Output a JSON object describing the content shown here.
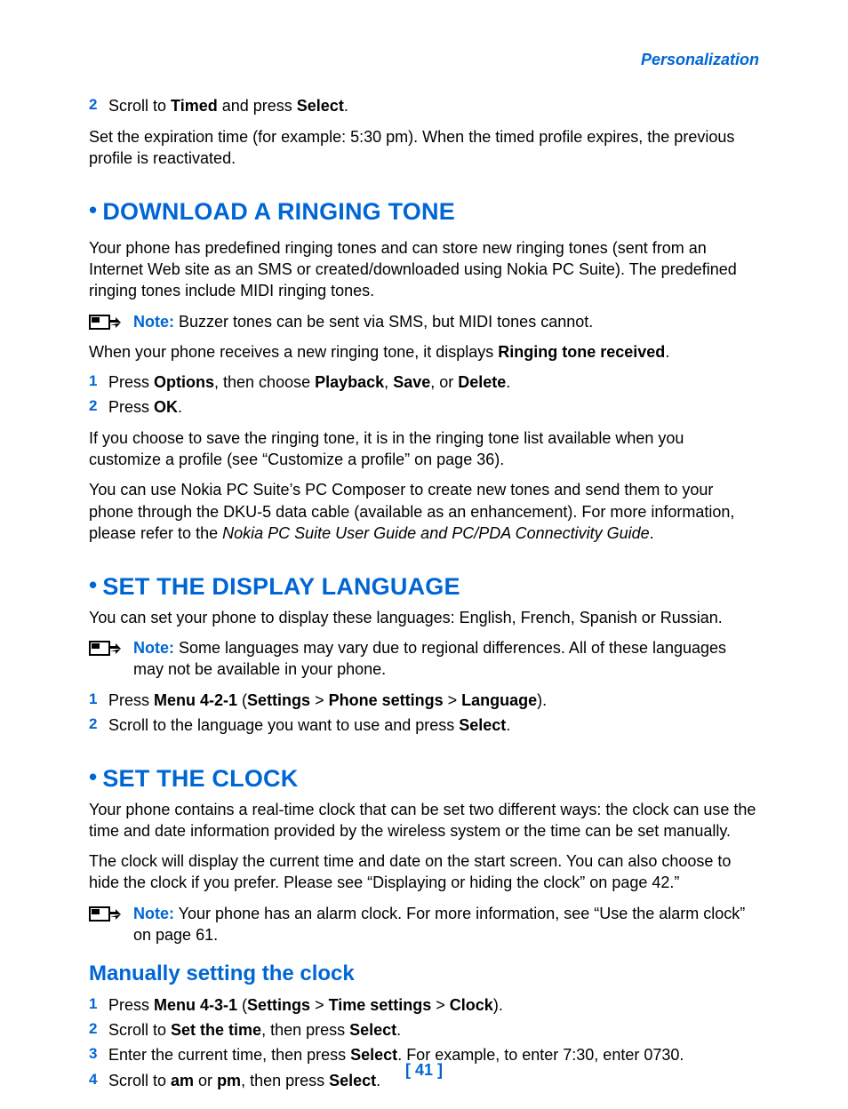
{
  "header": {
    "section": "Personalization"
  },
  "pre": {
    "step2_num": "2",
    "step2_prefix": "Scroll to ",
    "step2_b1": "Timed",
    "step2_mid": " and press ",
    "step2_b2": "Select",
    "step2_suffix": ".",
    "para": "Set the expiration time (for example: 5:30 pm). When the timed profile expires, the previous profile is reactivated."
  },
  "ringing": {
    "title": "DOWNLOAD A RINGING TONE",
    "p1": "Your phone has predefined ringing tones and can store new ringing tones (sent from an Internet Web site as an SMS or created/downloaded using Nokia PC Suite). The predefined ringing tones include MIDI ringing tones.",
    "note_label": "Note:",
    "note": " Buzzer tones can be sent via SMS, but MIDI tones cannot.",
    "p2_prefix": "When your phone receives a new ringing tone, it displays ",
    "p2_b": "Ringing tone received",
    "p2_suffix": ".",
    "s1_num": "1",
    "s1_a": "Press ",
    "s1_b1": "Options",
    "s1_c": ", then choose ",
    "s1_b2": "Playback",
    "s1_d": ", ",
    "s1_b3": "Save",
    "s1_e": ", or ",
    "s1_b4": "Delete",
    "s1_f": ".",
    "s2_num": "2",
    "s2_a": "Press ",
    "s2_b": "OK",
    "s2_c": ".",
    "p3": "If you choose to save the ringing tone, it is in the ringing tone list available when you customize a profile (see “Customize a profile” on page 36).",
    "p4_a": "You can use Nokia PC Suite’s PC Composer to create new tones and send them to your phone through the DKU-5 data cable (available as an enhancement). For more information, please refer to the ",
    "p4_i": "Nokia PC Suite User Guide and PC/PDA Connectivity Guide",
    "p4_b": "."
  },
  "lang": {
    "title": "SET THE DISPLAY LANGUAGE",
    "p1": "You can set your phone to display these languages: English, French, Spanish or Russian.",
    "note_label": "Note:",
    "note": " Some languages may vary due to regional differences. All of these languages may not be available in your phone.",
    "s1_num": "1",
    "s1_a": "Press ",
    "s1_b1": "Menu 4-2-1",
    "s1_c": " (",
    "s1_b2": "Settings",
    "s1_d": " > ",
    "s1_b3": "Phone settings",
    "s1_e": " > ",
    "s1_b4": "Language",
    "s1_f": ").",
    "s2_num": "2",
    "s2_a": "Scroll to the language you want to use and press ",
    "s2_b": "Select",
    "s2_c": "."
  },
  "clock": {
    "title": "SET THE CLOCK",
    "p1": "Your phone contains a real-time clock that can be set two different ways: the clock can use the time and date information provided by the wireless system or the time can be set manually.",
    "p2": "The clock will display the current time and date on the start screen. You can also choose to hide the clock if you prefer. Please see “Displaying or hiding the clock” on page 42.”",
    "note_label": "Note:",
    "note": " Your phone has an alarm clock. For more information, see “Use the alarm clock” on page 61.",
    "sub": "Manually setting the clock",
    "s1_num": "1",
    "s1_a": "Press ",
    "s1_b1": "Menu 4-3-1",
    "s1_c": " (",
    "s1_b2": "Settings",
    "s1_d": " > ",
    "s1_b3": "Time settings",
    "s1_e": " > ",
    "s1_b4": "Clock",
    "s1_f": ").",
    "s2_num": "2",
    "s2_a": "Scroll to ",
    "s2_b": "Set the time",
    "s2_c": ", then press ",
    "s2_b2": "Select",
    "s2_d": ".",
    "s3_num": "3",
    "s3_a": "Enter the current time, then press ",
    "s3_b": "Select",
    "s3_c": ". For example, to enter 7:30, enter 0730.",
    "s4_num": "4",
    "s4_a": "Scroll to ",
    "s4_b1": "am",
    "s4_c": " or ",
    "s4_b2": "pm",
    "s4_d": ", then press ",
    "s4_b3": "Select",
    "s4_e": "."
  },
  "footer": {
    "page": "[ 41 ]"
  }
}
